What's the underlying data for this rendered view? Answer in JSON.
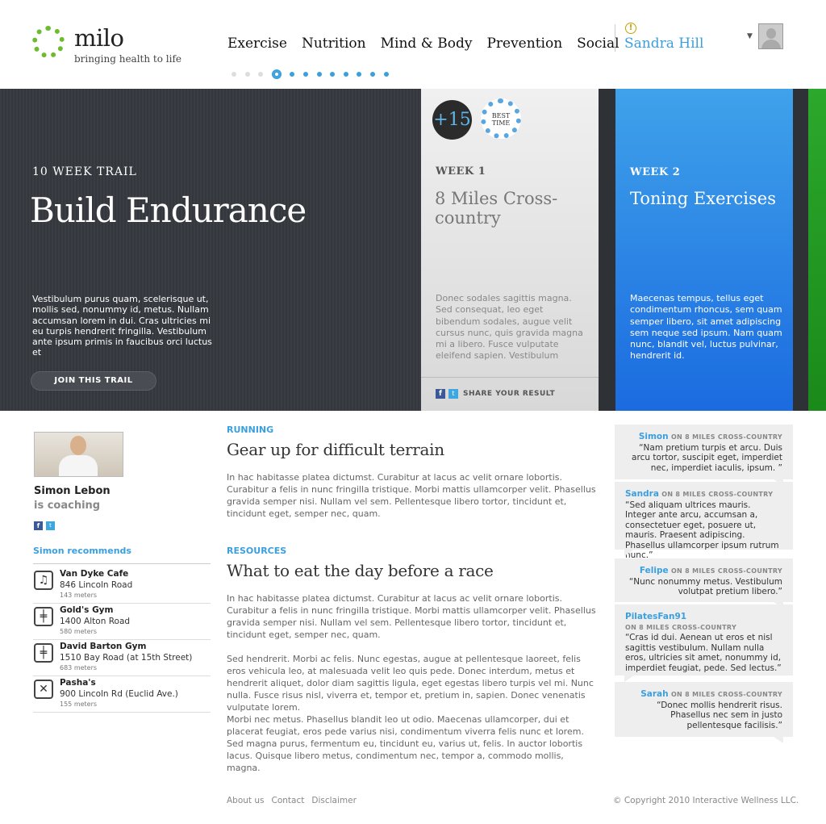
{
  "brand": {
    "name": "milo",
    "tagline": "bringing health to life"
  },
  "nav": {
    "items": [
      "Exercise",
      "Nutrition",
      "Mind & Body",
      "Prevention",
      "Social"
    ]
  },
  "user": {
    "name": "Sandra Hill",
    "alert": "!"
  },
  "pager": {
    "count": 12,
    "active_index": 3
  },
  "hero": {
    "kicker": "10 WEEK TRAIL",
    "title": "Build Endurance",
    "description": "Vestibulum purus quam, scelerisque ut, mollis sed, nonummy id, metus. Nullam accumsan lorem in dui. Cras ultricies mi eu turpis hendrerit fringilla. Vestibulum ante ipsum primis in faucibus orci luctus et",
    "cta": "JOIN THIS TRAIL"
  },
  "week1": {
    "badge_points": "+15",
    "badge_best": "BEST TIME",
    "label": "WEEK 1",
    "title": "8 Miles Cross-country",
    "description": "Donec sodales sagittis magna. Sed consequat, leo eget bibendum sodales, augue velit cursus nunc, quis gravida magna mi a libero. Fusce vulputate eleifend sapien. Vestibulum",
    "share": "SHARE YOUR RESULT",
    "colors": {
      "bg": "#e6e6e6"
    }
  },
  "week2": {
    "label": "WEEK 2",
    "title": "Toning Exercises",
    "description": "Maecenas tempus, tellus eget condimentum rhoncus, sem quam semper libero, sit amet adipiscing sem neque sed ipsum. Nam quam nunc, blandit vel, luctus pulvinar, hendrerit id.",
    "colors": {
      "bg": "#2a86e6"
    }
  },
  "coach": {
    "name": "Simon Lebon",
    "status": "is coaching",
    "recommends": "Simon recommends",
    "places": [
      {
        "name": "Van Dyke Cafe",
        "address": "846 Lincoln Road",
        "distance": "143 meters",
        "icon": "music-icon"
      },
      {
        "name": "Gold's Gym",
        "address": "1400 Alton Road",
        "distance": "580 meters",
        "icon": "dumbbell-icon"
      },
      {
        "name": "David Barton Gym",
        "address": "1510 Bay Road (at 15th Street)",
        "distance": "683 meters",
        "icon": "dumbbell-icon"
      },
      {
        "name": "Pasha's",
        "address": "900 Lincoln Rd (Euclid Ave.)",
        "distance": "155 meters",
        "icon": "utensils-icon"
      }
    ]
  },
  "articles": {
    "running": {
      "label": "RUNNING",
      "title": "Gear up for difficult terrain",
      "body": "In hac habitasse platea dictumst. Curabitur at lacus ac velit ornare lobortis. Curabitur a felis in nunc fringilla tristique. Morbi mattis ullamcorper velit. Phasellus gravida semper nisi. Nullam vel sem. Pellentesque libero tortor, tincidunt et, tincidunt eget, semper nec, quam."
    },
    "resources": {
      "label": "RESOURCES",
      "title": "What to eat the day before a race",
      "body1": "In hac habitasse platea dictumst. Curabitur at lacus ac velit ornare lobortis. Curabitur a felis in nunc fringilla tristique. Morbi mattis ullamcorper velit. Phasellus gravida semper nisi. Nullam vel sem. Pellentesque libero tortor, tincidunt et, tincidunt eget, semper nec, quam.",
      "body2": "Sed hendrerit. Morbi ac felis. Nunc egestas, augue at pellentesque laoreet, felis eros vehicula leo, at malesuada velit leo quis pede. Donec interdum, metus et hendrerit aliquet, dolor diam sagittis ligula, eget egestas libero turpis vel mi. Nunc nulla. Fusce risus nisl, viverra et, tempor et, pretium in, sapien. Donec venenatis vulputate lorem.",
      "body3": "Morbi nec metus. Phasellus blandit leo ut odio. Maecenas ullamcorper, dui et placerat feugiat, eros pede varius nisi, condimentum viverra felis nunc et lorem. Sed magna purus, fermentum eu, tincidunt eu, varius ut, felis. In auctor lobortis lacus. Quisque libero metus, condimentum nec, tempor a, commodo mollis, magna."
    }
  },
  "comments": [
    {
      "author": "Simon",
      "context": "ON 8 MILES CROSS-COUNTRY",
      "text": "“Nam pretium turpis et arcu. Duis arcu tortor, suscipit eget, imperdiet nec, imperdiet iaculis, ipsum. ”"
    },
    {
      "author": "Sandra",
      "context": "ON 8 MILES CROSS-COUNTRY",
      "text": "“Sed aliquam ultrices mauris. Integer ante arcu, accumsan a, consectetuer eget, posuere ut, mauris. Praesent adipiscing. Phasellus ullamcorper ipsum rutrum nunc.”"
    },
    {
      "author": "Felipe",
      "context": "ON 8 MILES CROSS-COUNTRY",
      "text": "“Nunc nonummy metus. Vestibulum volutpat pretium libero.”"
    },
    {
      "author": "PilatesFan91",
      "context": "ON 8 MILES CROSS-COUNTRY",
      "text": "“Cras id dui. Aenean ut eros et nisl sagittis vestibulum. Nullam nulla eros, ultricies sit amet, nonummy id, imperdiet feugiat, pede. Sed lectus.”"
    },
    {
      "author": "Sarah",
      "context": "ON 8 MILES CROSS-COUNTRY",
      "text": "“Donec mollis hendrerit risus. Phasellus nec sem in justo pellentesque facilisis.”"
    }
  ],
  "footer": {
    "links": [
      "About us",
      "Contact",
      "Disclaimer"
    ],
    "copyright": "© Copyright 2010 Interactive Wellness LLC."
  }
}
